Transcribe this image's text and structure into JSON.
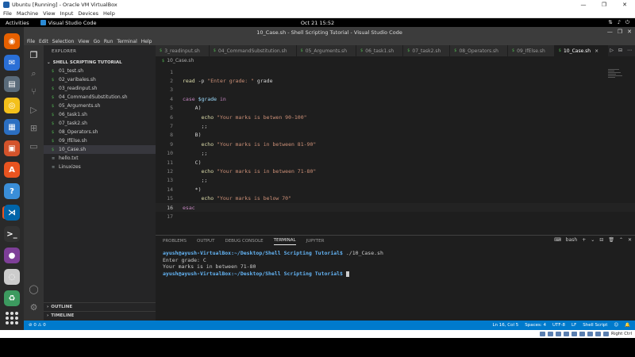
{
  "vbox": {
    "title": "Ubuntu [Running] - Oracle VM VirtualBox",
    "menu": [
      "File",
      "Machine",
      "View",
      "Input",
      "Devices",
      "Help"
    ],
    "controls": [
      "—",
      "❐",
      "✕"
    ],
    "host_key": "Right Ctrl"
  },
  "gnome": {
    "activities": "Activities",
    "app_name": "Visual Studio Code",
    "clock": "Oct 21  15:52",
    "status_icons": [
      "network-icon",
      "volume-icon",
      "power-icon"
    ]
  },
  "dock": {
    "apps": [
      {
        "name": "firefox",
        "color": "#e66000",
        "glyph": "◉"
      },
      {
        "name": "thunderbird",
        "color": "#2a6fd6",
        "glyph": "✉"
      },
      {
        "name": "files",
        "color": "#5a6b7a",
        "glyph": "▤"
      },
      {
        "name": "rhythmbox",
        "color": "#f3c01b",
        "glyph": "◎"
      },
      {
        "name": "libreoffice-writer",
        "color": "#2b6fc2",
        "glyph": "▦"
      },
      {
        "name": "libreoffice-impress",
        "color": "#d4532b",
        "glyph": "▣"
      },
      {
        "name": "app-center",
        "color": "#e95420",
        "glyph": "A"
      },
      {
        "name": "help",
        "color": "#3a8ed8",
        "glyph": "?"
      },
      {
        "name": "visual-studio-code",
        "color": "#0065a9",
        "glyph": "⋊"
      },
      {
        "name": "terminal",
        "color": "#333333",
        "glyph": ">_"
      },
      {
        "name": "purple-app",
        "color": "#7e3f98",
        "glyph": "●"
      },
      {
        "name": "disc",
        "color": "#cccccc",
        "glyph": "◌"
      },
      {
        "name": "trash",
        "color": "#3c9a5f",
        "glyph": "♻"
      }
    ]
  },
  "vscode": {
    "title": "10_Case.sh - Shell Scripting Tutorial - Visual Studio Code",
    "menu": [
      "File",
      "Edit",
      "Selection",
      "View",
      "Go",
      "Run",
      "Terminal",
      "Help"
    ],
    "win_controls": [
      "—",
      "❐",
      "✕"
    ],
    "explorer": {
      "header": "EXPLORER",
      "folder": "SHELL SCRIPTING TUTORIAL",
      "files": [
        {
          "name": "01_test.sh",
          "type": "sh"
        },
        {
          "name": "02_varibales.sh",
          "type": "sh"
        },
        {
          "name": "03_readinput.sh",
          "type": "sh"
        },
        {
          "name": "04_CommandSubstitution.sh",
          "type": "sh"
        },
        {
          "name": "05_Arguments.sh",
          "type": "sh"
        },
        {
          "name": "06_task1.sh",
          "type": "sh"
        },
        {
          "name": "07_task2.sh",
          "type": "sh"
        },
        {
          "name": "08_Operators.sh",
          "type": "sh"
        },
        {
          "name": "09_IfElse.sh",
          "type": "sh"
        },
        {
          "name": "10_Case.sh",
          "type": "sh",
          "selected": true
        },
        {
          "name": "hello.txt",
          "type": "txt"
        },
        {
          "name": "Linuxizes",
          "type": "txt"
        }
      ],
      "outline": "OUTLINE",
      "timeline": "TIMELINE"
    },
    "tabs": [
      {
        "name": "3_readinput.sh"
      },
      {
        "name": "04_CommandSubstitution.sh"
      },
      {
        "name": "05_Arguments.sh"
      },
      {
        "name": "06_task1.sh"
      },
      {
        "name": "07_task2.sh"
      },
      {
        "name": "08_Operators.sh"
      },
      {
        "name": "09_IfElse.sh"
      },
      {
        "name": "10_Case.sh",
        "active": true
      }
    ],
    "breadcrumb": "10_Case.sh",
    "code_lines": [
      {
        "n": "1",
        "tokens": []
      },
      {
        "n": "2",
        "tokens": [
          {
            "t": "read",
            "c": "b"
          },
          {
            "t": " -p ",
            "c": "p"
          },
          {
            "t": "\"Enter grade: \"",
            "c": "s"
          },
          {
            "t": " grade",
            "c": "p"
          }
        ]
      },
      {
        "n": "3",
        "tokens": []
      },
      {
        "n": "4",
        "tokens": [
          {
            "t": "case",
            "c": "k"
          },
          {
            "t": " ",
            "c": "p"
          },
          {
            "t": "$grade",
            "c": "v"
          },
          {
            "t": " ",
            "c": "p"
          },
          {
            "t": "in",
            "c": "k"
          }
        ]
      },
      {
        "n": "5",
        "tokens": [
          {
            "t": "    A)",
            "c": "p"
          }
        ]
      },
      {
        "n": "6",
        "tokens": [
          {
            "t": "      ",
            "c": "p"
          },
          {
            "t": "echo",
            "c": "b"
          },
          {
            "t": " ",
            "c": "p"
          },
          {
            "t": "\"Your marks is betwen 90-100\"",
            "c": "s"
          }
        ]
      },
      {
        "n": "7",
        "tokens": [
          {
            "t": "      ;;",
            "c": "p"
          }
        ]
      },
      {
        "n": "8",
        "tokens": [
          {
            "t": "    B)",
            "c": "p"
          }
        ]
      },
      {
        "n": "9",
        "tokens": [
          {
            "t": "      ",
            "c": "p"
          },
          {
            "t": "echo",
            "c": "b"
          },
          {
            "t": " ",
            "c": "p"
          },
          {
            "t": "\"Your marks is in between 81-90\"",
            "c": "s"
          }
        ]
      },
      {
        "n": "10",
        "tokens": [
          {
            "t": "      ;;",
            "c": "p"
          }
        ]
      },
      {
        "n": "11",
        "tokens": [
          {
            "t": "    C)",
            "c": "p"
          }
        ]
      },
      {
        "n": "12",
        "tokens": [
          {
            "t": "      ",
            "c": "p"
          },
          {
            "t": "echo",
            "c": "b"
          },
          {
            "t": " ",
            "c": "p"
          },
          {
            "t": "\"Your marks is in between 71-80\"",
            "c": "s"
          }
        ]
      },
      {
        "n": "13",
        "tokens": [
          {
            "t": "      ;;",
            "c": "p"
          }
        ]
      },
      {
        "n": "14",
        "tokens": [
          {
            "t": "    *)",
            "c": "p"
          }
        ]
      },
      {
        "n": "15",
        "tokens": [
          {
            "t": "      ",
            "c": "p"
          },
          {
            "t": "echo",
            "c": "b"
          },
          {
            "t": " ",
            "c": "p"
          },
          {
            "t": "\"Your marks is below 70\"",
            "c": "s"
          }
        ]
      },
      {
        "n": "16",
        "tokens": [
          {
            "t": "esac",
            "c": "k"
          }
        ],
        "current": true
      },
      {
        "n": "17",
        "tokens": []
      }
    ],
    "panel": {
      "tabs": [
        "PROBLEMS",
        "OUTPUT",
        "DEBUG CONSOLE",
        "TERMINAL",
        "JUPYTER"
      ],
      "active_tab": "TERMINAL",
      "shell": "bash",
      "terminal_lines": [
        {
          "user": "ayush@ayush-VirtualBox",
          "path": ":~/Desktop/Shell Scripting Tutorial$",
          "cmd": " ./10_Case.sh"
        },
        {
          "text": "Enter grade: C"
        },
        {
          "text": "Your marks is in between 71-80"
        },
        {
          "user": "ayush@ayush-VirtualBox",
          "path": ":~/Desktop/Shell Scripting Tutorial$",
          "cmd": " ",
          "cursor": true
        }
      ]
    },
    "statusbar": {
      "problems": "⊘ 0 ⚠ 0",
      "position": "Ln 16, Col 5",
      "spaces": "Spaces: 4",
      "encoding": "UTF-8",
      "eol": "LF",
      "language": "Shell Script"
    }
  }
}
